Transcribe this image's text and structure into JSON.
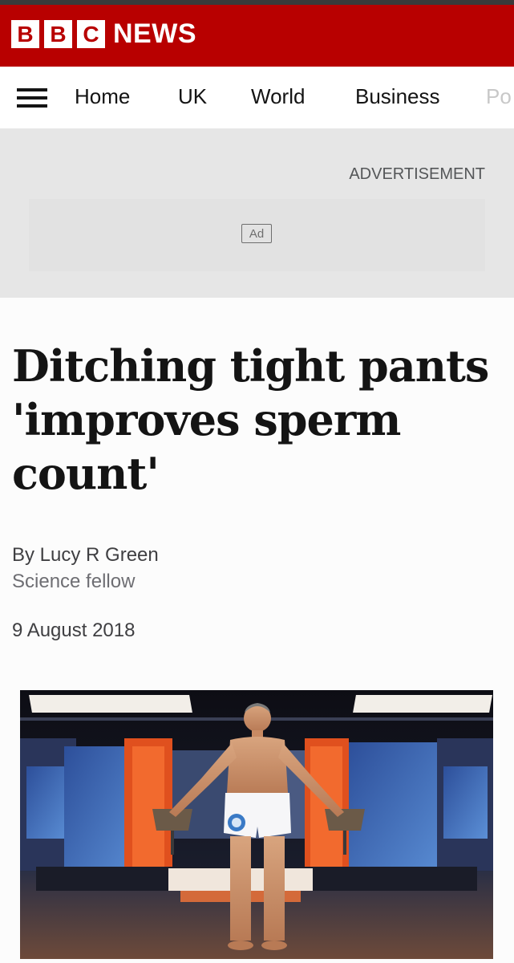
{
  "masthead": {
    "logo_letters": [
      "B",
      "B",
      "C"
    ],
    "logo_word": "NEWS",
    "brand_color": "#b80000"
  },
  "nav": {
    "menu_icon": "hamburger-menu-icon",
    "items": [
      "Home",
      "UK",
      "World",
      "Business",
      "Po"
    ]
  },
  "advertisement": {
    "label": "ADVERTISEMENT",
    "badge": "Ad"
  },
  "article": {
    "headline": "Ditching tight pants 'improves sperm count'",
    "byline": "By Lucy R Green",
    "role": "Science fellow",
    "date": "9 August 2018"
  }
}
